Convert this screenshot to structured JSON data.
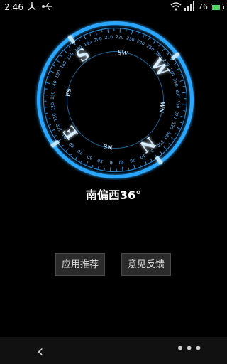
{
  "status_bar": {
    "time": "2:46",
    "battery_level": "76",
    "battery_fraction": 0.76,
    "icons": [
      "usb-share-icon",
      "usb-icon",
      "wifi-icon",
      "signal-icon",
      "battery-icon"
    ]
  },
  "compass": {
    "cardinals": [
      "S",
      "W",
      "N",
      "E"
    ],
    "intercardinals": [
      "SW",
      "WN",
      "NS",
      "ES"
    ],
    "degree_labels": [
      "180",
      "190",
      "200",
      "210",
      "220",
      "230",
      "240",
      "250",
      "260",
      "270",
      "280",
      "290",
      "300",
      "310",
      "320",
      "330",
      "340",
      "350",
      "0",
      "10",
      "20",
      "30",
      "40",
      "50",
      "60",
      "70",
      "80",
      "90",
      "100",
      "110",
      "120",
      "130",
      "140",
      "150",
      "160",
      "170"
    ],
    "heading_degrees": 216,
    "glow_color": "#2aa6ff"
  },
  "heading_text": "南偏西36°",
  "buttons": {
    "recommend": "应用推荐",
    "feedback": "意见反馈"
  },
  "navbar": {
    "back_symbol": "‹",
    "more_symbol": "•••"
  }
}
